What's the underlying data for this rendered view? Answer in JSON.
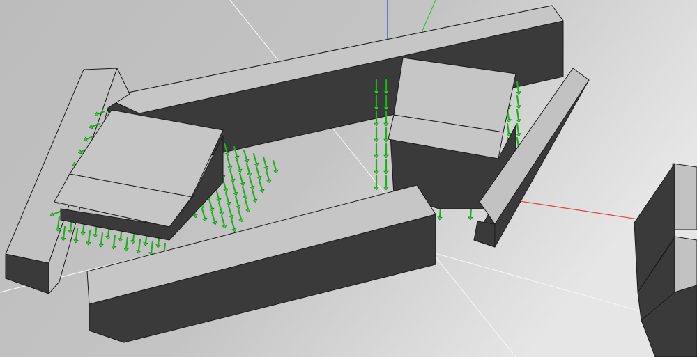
{
  "viewer": {
    "background_light": "#f2f2f2",
    "background_dark": "#b9b9b9",
    "colors": {
      "block_top": "#c6c6c6",
      "block_side": "#3a3a3a",
      "edge": "#1a1a1a",
      "normal_vectors": "#2ee02e",
      "axis_x": "#e34040",
      "axis_y": "#32c832",
      "axis_z": "#2b3df0"
    }
  }
}
